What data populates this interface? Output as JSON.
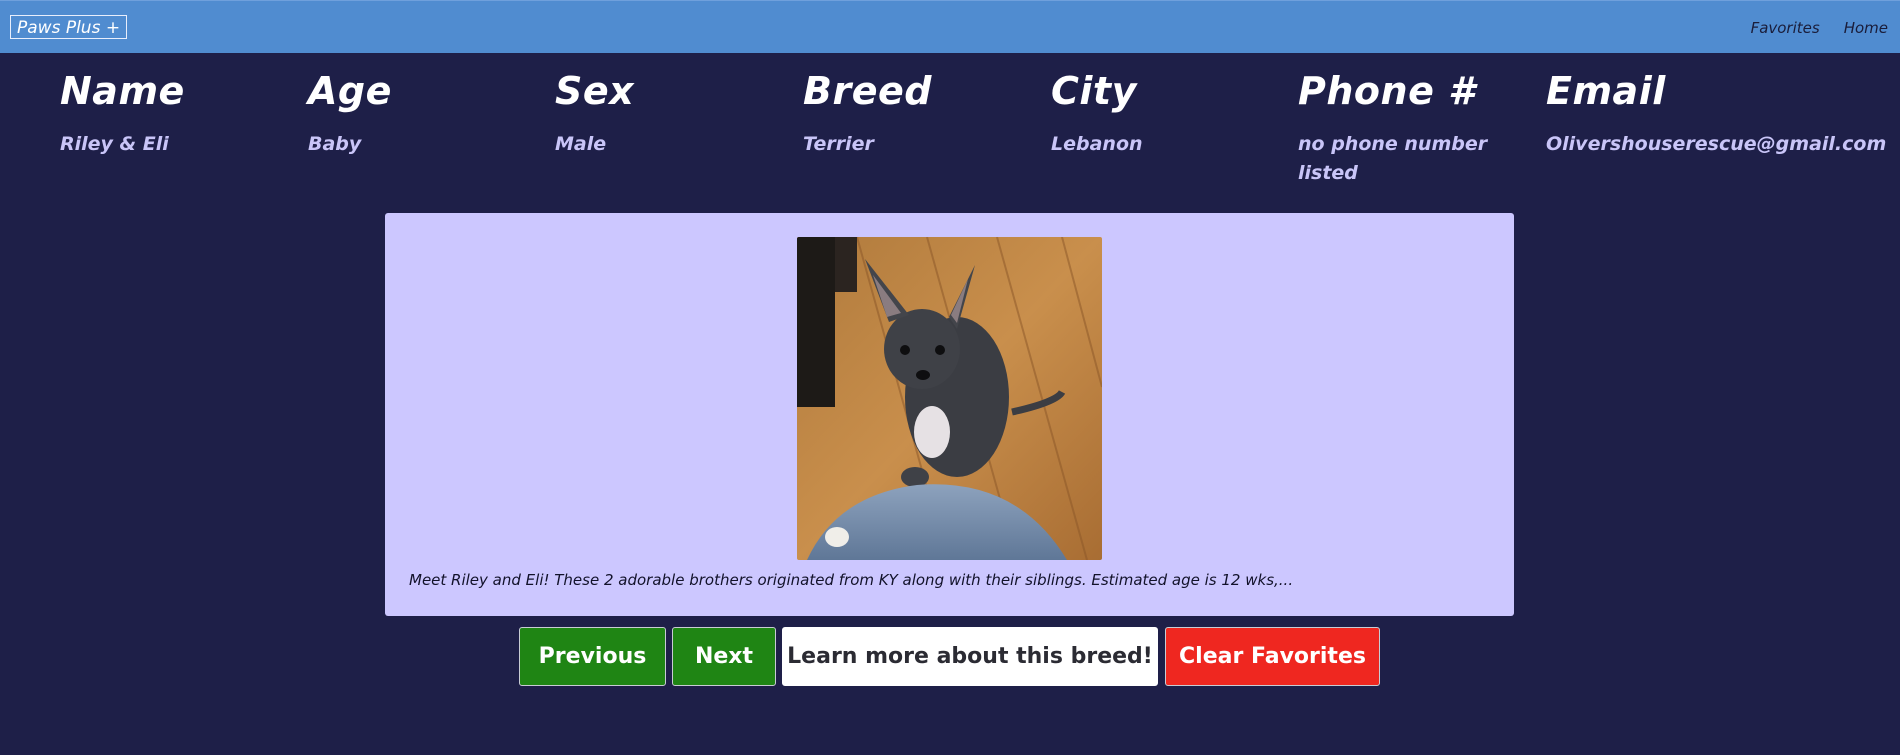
{
  "navbar": {
    "brand": "Paws Plus +",
    "links": [
      "Favorites",
      "Home"
    ]
  },
  "info": {
    "headers": [
      "Name",
      "Age",
      "Sex",
      "Breed",
      "City",
      "Phone #",
      "Email"
    ],
    "values": [
      "Riley & Eli",
      "Baby",
      "Male",
      "Terrier",
      "Lebanon",
      "no phone number listed",
      "Olivershouserescue@gmail.com"
    ]
  },
  "card": {
    "photo_icon": "puppy-photo",
    "description": "Meet Riley and Eli! These 2 adorable brothers originated from KY along with their siblings. Estimated age is 12 wks,..."
  },
  "buttons": {
    "previous": "Previous",
    "next": "Next",
    "learn_more": "Learn more about this breed!",
    "clear_favorites": "Clear Favorites"
  },
  "colors": {
    "background": "#1e1f48",
    "navbar": "#508cd0",
    "card": "#ccc7ff",
    "green_button": "#1f8514",
    "red_button": "#ef2720"
  }
}
